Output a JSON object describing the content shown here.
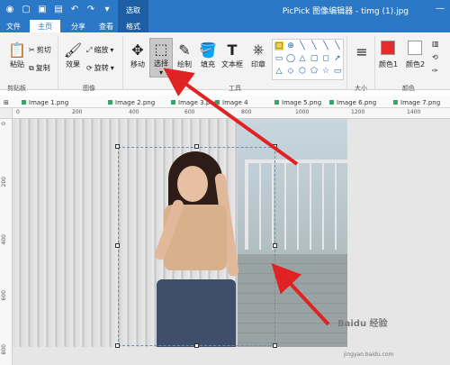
{
  "app": {
    "title": "PicPick 图像编辑器 - timg (1).jpg"
  },
  "qat": {
    "icons": [
      "app-logo-icon",
      "open-icon",
      "save-icon",
      "print-icon",
      "undo-icon",
      "redo-icon"
    ]
  },
  "context_tab_group": "选取",
  "tabs": [
    {
      "label": "文件"
    },
    {
      "label": "主页"
    },
    {
      "label": "分享"
    },
    {
      "label": "查看"
    },
    {
      "label": "格式"
    }
  ],
  "ribbon": {
    "clipboard": {
      "paste": "粘贴",
      "cut": "剪切",
      "copy": "复制",
      "group": "剪贴板"
    },
    "image": {
      "effects": "效果",
      "resize": "缩放",
      "rotate": "旋转",
      "group": "图像"
    },
    "tools": {
      "move": "移动",
      "select": "选择",
      "draw": "绘制",
      "fill": "填充",
      "textbox": "文本框",
      "stamp": "印章",
      "group": "工具"
    },
    "size_group": "大小",
    "colors": {
      "color1": "颜色1",
      "color2": "颜色2",
      "group": "颜色"
    }
  },
  "image_tabs": [
    "Image 1.png",
    "Image 2.png",
    "Image 3.png",
    "Image 4",
    "Image 5.png",
    "Image 6.png",
    "Image 7.png"
  ],
  "ruler": {
    "h": [
      "0",
      "200",
      "400",
      "600",
      "800",
      "1000",
      "1200",
      "1400"
    ],
    "v": [
      "0",
      "200",
      "400",
      "600",
      "800"
    ]
  },
  "watermark": {
    "line1": "Baidu 经验",
    "line2": "jingyan.baidu.com"
  },
  "theme": {
    "accent": "#2b78c6",
    "color1": "#e52b2b",
    "arrow": "#e02222"
  }
}
